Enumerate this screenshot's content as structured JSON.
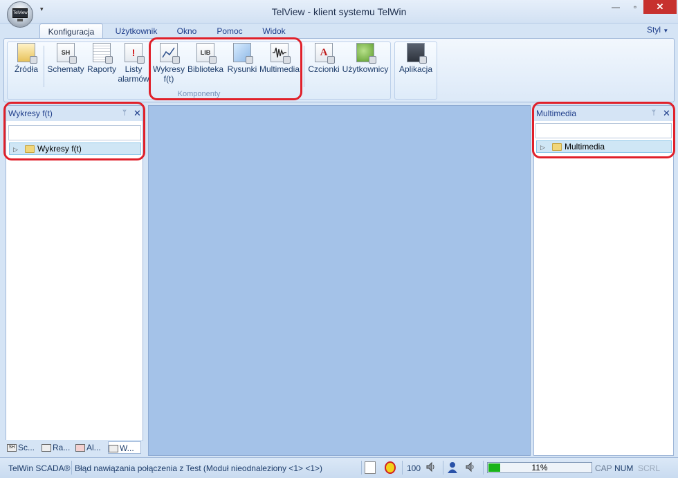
{
  "window": {
    "title": "TelView - klient systemu TelWin",
    "app_badge": "TelView",
    "qat_arrow": "▾",
    "minimize": "—",
    "maximize": "▫",
    "close": "✕"
  },
  "tabs": [
    {
      "label": "Konfiguracja",
      "active": true
    },
    {
      "label": "Użytkownik"
    },
    {
      "label": "Okno"
    },
    {
      "label": "Pomoc"
    },
    {
      "label": "Widok"
    }
  ],
  "style_menu": "Styl",
  "ribbon": {
    "buttons": [
      {
        "label": "Źródła",
        "icon": "sources-icon"
      },
      {
        "label": "Schematy",
        "icon": "schematics-icon",
        "glyph": "SH"
      },
      {
        "label": "Raporty",
        "icon": "reports-icon"
      },
      {
        "label1": "Listy",
        "label2": "alarmów",
        "icon": "alarm-list-icon",
        "glyph": "!"
      },
      {
        "label1": "Wykresy",
        "label2": "f(t)",
        "icon": "chart-icon"
      },
      {
        "label": "Biblioteka",
        "icon": "library-icon",
        "glyph": "LIB"
      },
      {
        "label": "Rysunki",
        "icon": "drawings-icon"
      },
      {
        "label": "Multimedia",
        "icon": "multimedia-icon"
      },
      {
        "label": "Czcionki",
        "icon": "fonts-icon",
        "glyph": "A"
      },
      {
        "label": "Użytkownicy",
        "icon": "users-icon"
      },
      {
        "label": "Aplikacja",
        "icon": "application-icon"
      }
    ],
    "group_label": "Komponenty"
  },
  "left_panel": {
    "title": "Wykresy f(t)",
    "pin": "ᛘ",
    "close": "✕",
    "search_value": "",
    "tree_item": "Wykresy f(t)",
    "expander": "▷"
  },
  "right_panel": {
    "title": "Multimedia",
    "pin": "ᛘ",
    "close": "✕",
    "search_value": "",
    "tree_item": "Multimedia",
    "expander": "▷"
  },
  "bottom_tabs": [
    {
      "label": "Sc...",
      "glyph": "SH"
    },
    {
      "label": "Ra..."
    },
    {
      "label": "Al..."
    },
    {
      "label": "W...",
      "active": true
    }
  ],
  "statusbar": {
    "product": "TelWin SCADA®",
    "message": "Błąd nawiązania połączenia z Test (Moduł nieodnaleziony <1> <1>)",
    "value": "100",
    "progress_text": "11%",
    "progress": 0.11,
    "cap": "CAP",
    "num": "NUM",
    "scrl": "SCRL"
  },
  "colors": {
    "highlight": "#e0202a",
    "progress_fill": "#19b319",
    "workspace": "#a4c2e8",
    "close_button": "#c7312e"
  }
}
